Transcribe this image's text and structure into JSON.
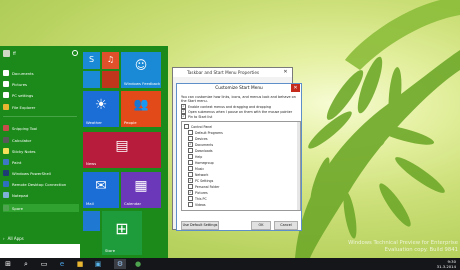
{
  "watermark": {
    "line1": "Windows Technical Preview for Enterprise",
    "line2": "Evaluation copy. Build 9841"
  },
  "start_menu": {
    "user_name": "ff",
    "left_items": [
      {
        "label": "Documents",
        "color": "#ffffff"
      },
      {
        "label": "Pictures",
        "color": "#ffffff"
      },
      {
        "label": "PC settings",
        "color": "#ffffff"
      },
      {
        "label": "File Explorer",
        "color": "#e8b631"
      },
      {
        "label": "Snipping Tool",
        "color": "#c94b4b"
      },
      {
        "label": "Calculator",
        "color": "#5a5a5a"
      },
      {
        "label": "Sticky Notes",
        "color": "#f5e25a"
      },
      {
        "label": "Paint",
        "color": "#3e78c4"
      },
      {
        "label": "Windows PowerShell",
        "color": "#1f3b73"
      },
      {
        "label": "Remote Desktop Connection",
        "color": "#2f6fbf"
      },
      {
        "label": "Notepad",
        "color": "#7fb1d8"
      },
      {
        "label": "Spore",
        "color": "#4ea34e"
      }
    ],
    "all_apps": "All Apps",
    "tiles": [
      {
        "name": "skype",
        "label": "",
        "color": "#1a8ad6",
        "glyph": "S"
      },
      {
        "name": "music",
        "label": "",
        "color": "#e0502a",
        "glyph": "♫"
      },
      {
        "name": "feedback",
        "label": "Windows Feedback",
        "color": "#1a8ad6",
        "glyph": "☺"
      },
      {
        "name": "people",
        "label": "People",
        "color": "#e34a1a",
        "glyph": "👥"
      },
      {
        "name": "weather",
        "label": "Weather",
        "color": "#1a6ed6",
        "glyph": "☀"
      },
      {
        "name": "news",
        "label": "News",
        "color": "#b81c3c",
        "glyph": "▤"
      },
      {
        "name": "mail",
        "label": "Mail",
        "color": "#1a6ed6",
        "glyph": "✉"
      },
      {
        "name": "calendar",
        "label": "Calendar",
        "color": "#6a38b8",
        "glyph": "▦"
      },
      {
        "name": "store",
        "label": "Store",
        "color": "#1e9b3b",
        "glyph": "⊞"
      },
      {
        "name": "photos",
        "label": "",
        "color": "#1a8ad6",
        "glyph": ""
      },
      {
        "name": "video",
        "label": "",
        "color": "#c0361c",
        "glyph": ""
      },
      {
        "name": "onedrive",
        "label": "",
        "color": "#1f78d1",
        "glyph": ""
      }
    ]
  },
  "dialog_back": {
    "title": "Taskbar and Start Menu Properties"
  },
  "dialog": {
    "title": "Customize Start Menu",
    "description": "You can customize how links, icons, and menus look and behave on the Start menu.",
    "options": [
      {
        "label": "Enable context menus and dragging and dropping",
        "checked": true
      },
      {
        "label": "Open submenus when I pause on them with the mouse pointer",
        "checked": true
      },
      {
        "label": "Pin to Start list",
        "checked": true
      }
    ],
    "list_items": [
      {
        "label": "Control Panel",
        "checked": false
      },
      {
        "label": "Default Programs",
        "checked": false
      },
      {
        "label": "Devices",
        "checked": false
      },
      {
        "label": "Documents",
        "checked": true
      },
      {
        "label": "Downloads",
        "checked": false
      },
      {
        "label": "Help",
        "checked": false
      },
      {
        "label": "Homegroup",
        "checked": false
      },
      {
        "label": "Music",
        "checked": false
      },
      {
        "label": "Network",
        "checked": false
      },
      {
        "label": "PC Settings",
        "checked": true
      },
      {
        "label": "Personal Folder",
        "checked": false
      },
      {
        "label": "Pictures",
        "checked": true
      },
      {
        "label": "This PC",
        "checked": false
      },
      {
        "label": "Videos",
        "checked": false
      }
    ],
    "use_default": "Use Default Settings",
    "ok": "OK",
    "cancel": "Cancel"
  },
  "taskbar": {
    "time": "9:30",
    "date": "31.3.2014"
  }
}
